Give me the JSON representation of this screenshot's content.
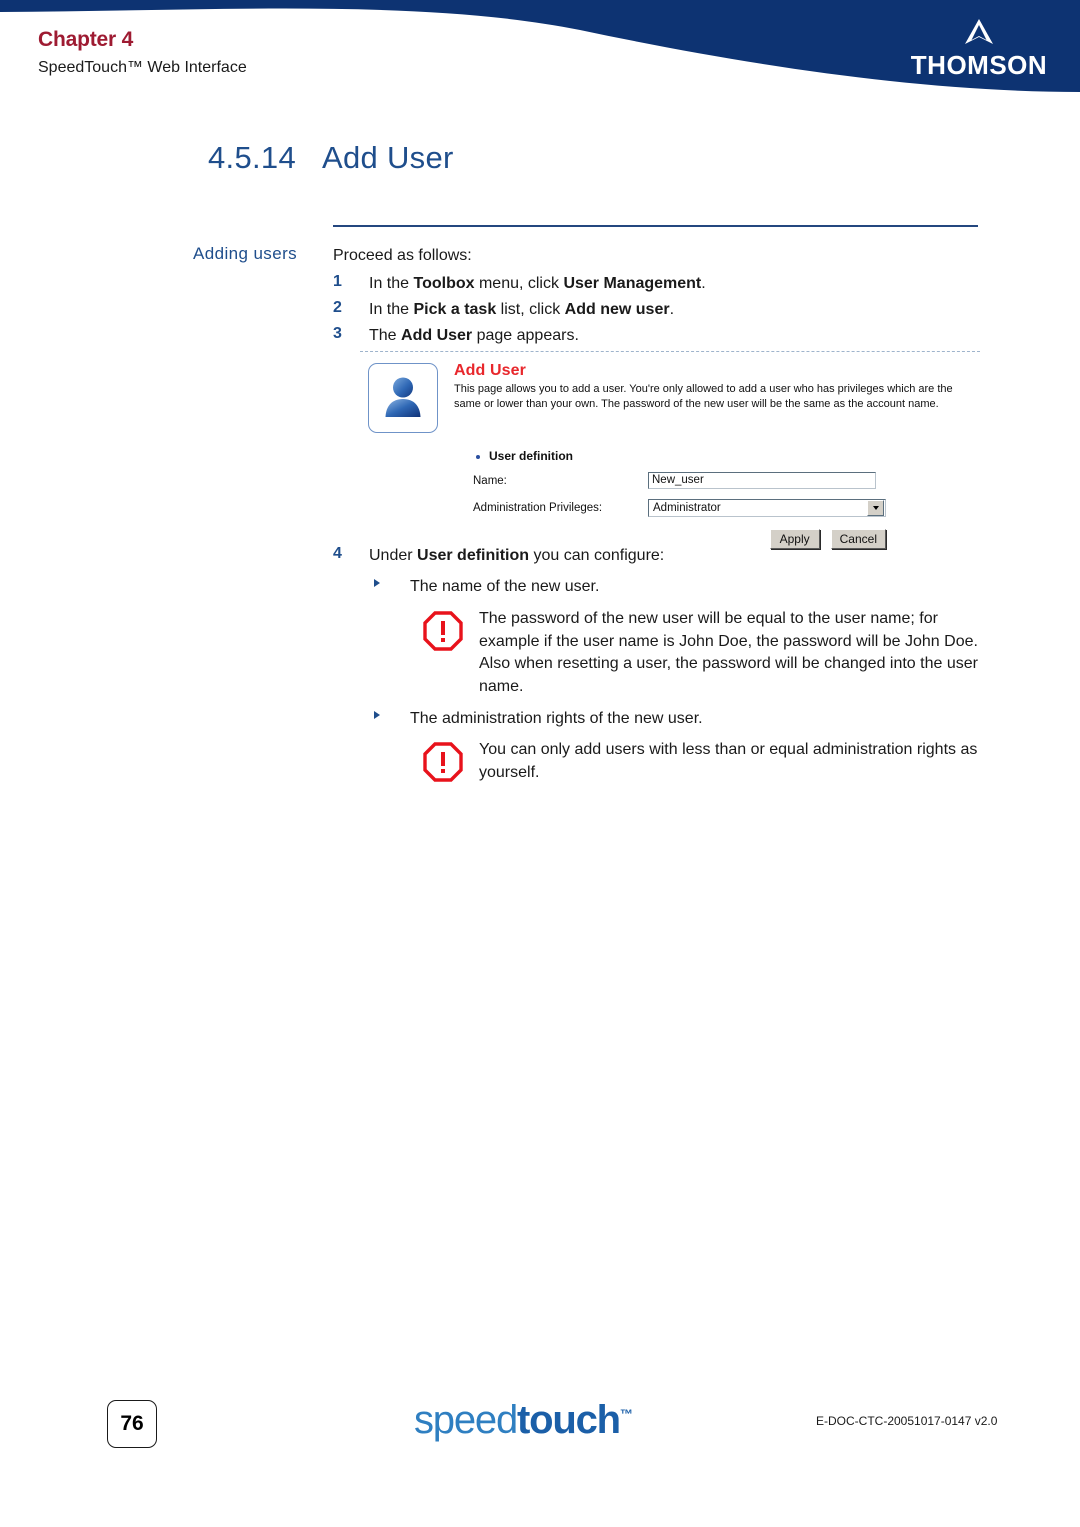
{
  "header": {
    "chapter_label": "Chapter 4",
    "subtitle": "SpeedTouch™ Web Interface",
    "brand": "THOMSON",
    "brand_color": "#0d3372",
    "chapter_color": "#9e1b32"
  },
  "section": {
    "number": "4.5.14",
    "title": "Add User",
    "color": "#1f4e8c"
  },
  "marginal": {
    "label": "Adding users"
  },
  "intro": {
    "lead": "Proceed as follows:"
  },
  "steps": [
    {
      "num": "1",
      "parts": [
        {
          "text": "In the ",
          "bold": false
        },
        {
          "text": "Toolbox",
          "bold": true
        },
        {
          "text": " menu, click ",
          "bold": false
        },
        {
          "text": "User Management",
          "bold": true
        },
        {
          "text": ".",
          "bold": false
        }
      ]
    },
    {
      "num": "2",
      "parts": [
        {
          "text": "In the ",
          "bold": false
        },
        {
          "text": "Pick a task",
          "bold": true
        },
        {
          "text": " list, click ",
          "bold": false
        },
        {
          "text": "Add new user",
          "bold": true
        },
        {
          "text": ".",
          "bold": false
        }
      ]
    },
    {
      "num": "3",
      "parts": [
        {
          "text": "The ",
          "bold": false
        },
        {
          "text": "Add User",
          "bold": true
        },
        {
          "text": " page appears.",
          "bold": false
        }
      ]
    }
  ],
  "embedded_screenshot": {
    "avatar_icon": "user-avatar-icon",
    "title": "Add User",
    "title_color": "#e8272c",
    "description": "This page allows you to add a user. You're only allowed to add a user who has privileges which are the same or lower than your own. The password of the new user will be the same as the account name.",
    "section_heading": "User definition",
    "fields": [
      {
        "label": "Name:",
        "type": "text",
        "value": "New_user",
        "placeholder": ""
      },
      {
        "label": "Administration Privileges:",
        "type": "select",
        "value": "Administrator",
        "options": [
          "Administrator"
        ]
      }
    ],
    "buttons": [
      {
        "label": "Apply",
        "name": "apply-button"
      },
      {
        "label": "Cancel",
        "name": "cancel-button"
      }
    ]
  },
  "step4": {
    "num": "4",
    "parts": [
      {
        "text": "Under ",
        "bold": false
      },
      {
        "text": "User definition",
        "bold": true
      },
      {
        "text": " you can configure:",
        "bold": false
      }
    ]
  },
  "bullets": [
    {
      "text": "The name of the new user.",
      "warning": "The password of the new user will be equal to the user name; for example if the user name is John Doe, the password will be John Doe. Also when resetting a user, the password will be changed into the user name.",
      "warning_icon": "warning-octagon-icon"
    },
    {
      "text": "The administration rights of the new user.",
      "warning": "You can only add users with less than or equal administration rights as yourself.",
      "warning_icon": "warning-octagon-icon"
    }
  ],
  "footer": {
    "page_number": "76",
    "logo_part1": "speed",
    "logo_part2": "touch",
    "logo_tm": "™",
    "doc_code": "E-DOC-CTC-20051017-0147 v2.0"
  }
}
